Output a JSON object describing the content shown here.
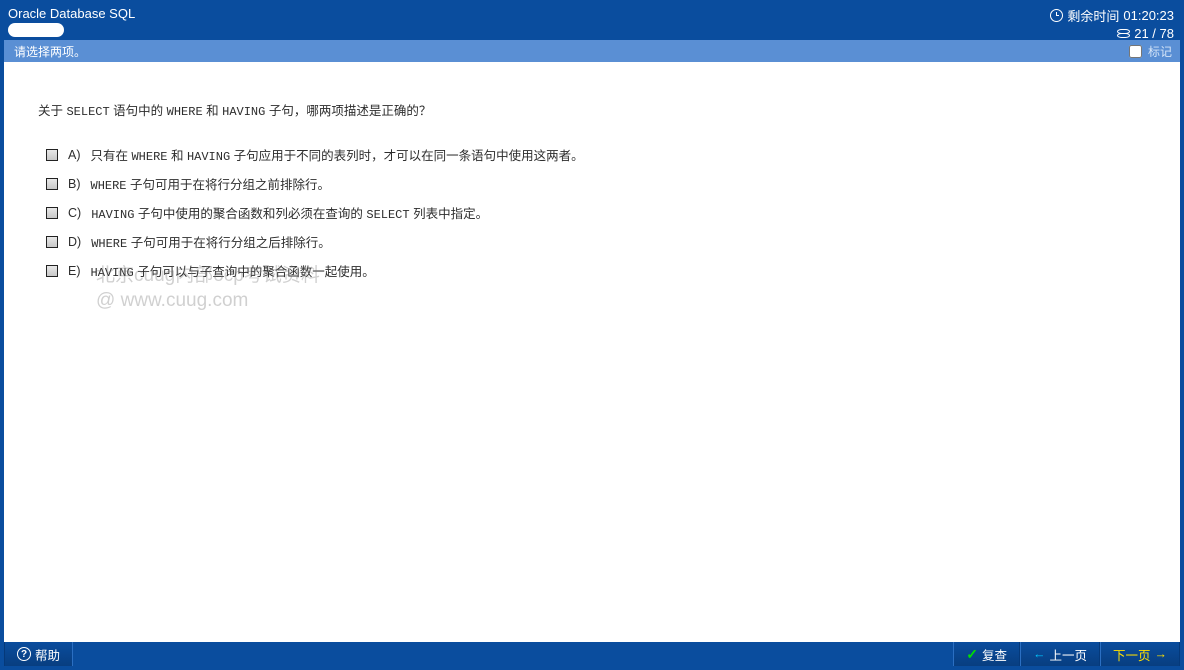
{
  "header": {
    "title": "Oracle Database SQL",
    "timer_label": "剩余时间",
    "timer_value": "01:20:23",
    "progress": "21 / 78"
  },
  "instruction_bar": {
    "text": "请选择两项。",
    "mark_label": "标记"
  },
  "question": {
    "prefix": "关于 ",
    "kw1": "SELECT",
    "mid1": " 语句中的 ",
    "kw2": "WHERE",
    "mid2": " 和 ",
    "kw3": "HAVING",
    "suffix": " 子句，哪两项描述是正确的？"
  },
  "options": [
    {
      "label": "A)",
      "pre": "只有在 ",
      "c1": "WHERE",
      "mid": " 和 ",
      "c2": "HAVING",
      "post": " 子句应用于不同的表列时，才可以在同一条语句中使用这两者。"
    },
    {
      "label": "B)",
      "pre": "",
      "c1": "WHERE",
      "mid": "",
      "c2": "",
      "post": " 子句可用于在将行分组之前排除行。"
    },
    {
      "label": "C)",
      "pre": "",
      "c1": "HAVING",
      "mid": " 子句中使用的聚合函数和列必须在查询的 ",
      "c2": "SELECT",
      "post": " 列表中指定。"
    },
    {
      "label": "D)",
      "pre": "",
      "c1": "WHERE",
      "mid": "",
      "c2": "",
      "post": " 子句可用于在将行分组之后排除行。"
    },
    {
      "label": "E)",
      "pre": "",
      "c1": "HAVING",
      "mid": "",
      "c2": "",
      "post": " 子句可以与子查询中的聚合函数一起使用。"
    }
  ],
  "watermark": {
    "line1": "北京cuug内部ocp考试资料",
    "line2": "@ www.cuug.com"
  },
  "footer": {
    "help": "帮助",
    "review": "复查",
    "prev": "上一页",
    "next": "下一页"
  }
}
